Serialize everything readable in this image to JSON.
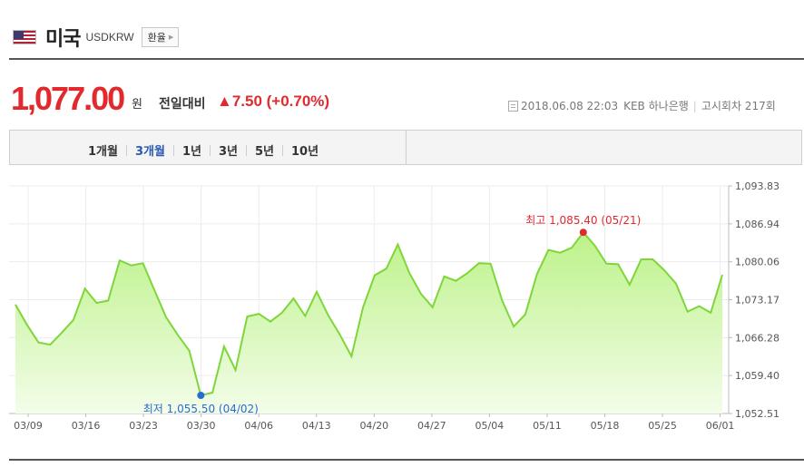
{
  "header": {
    "country": "미국",
    "code": "USDKRW",
    "rate_button": "환율"
  },
  "summary": {
    "price": "1,077.00",
    "unit": "원",
    "change_label": "전일대비",
    "change_value": "▲7.50 (+0.70%)",
    "datetime": "2018.06.08 22:03",
    "bank": "KEB 하나은행",
    "notice": "고시회차 217회"
  },
  "tabs": [
    {
      "label": "1개월",
      "active": false
    },
    {
      "label": "3개월",
      "active": true
    },
    {
      "label": "1년",
      "active": false
    },
    {
      "label": "3년",
      "active": false
    },
    {
      "label": "5년",
      "active": false
    },
    {
      "label": "10년",
      "active": false
    }
  ],
  "chart_data": {
    "type": "area",
    "x_tick_labels": [
      "03/09",
      "03/16",
      "03/23",
      "03/30",
      "04/06",
      "04/13",
      "04/20",
      "04/27",
      "05/04",
      "05/11",
      "05/18",
      "05/25",
      "06/01"
    ],
    "y_tick_labels": [
      "1,093.83",
      "1,086.94",
      "1,080.06",
      "1,073.17",
      "1,066.28",
      "1,059.40",
      "1,052.51"
    ],
    "ylim": [
      1052.51,
      1093.83
    ],
    "grid": true,
    "colors": {
      "line": "#7fd63a",
      "fill_top": "#bdf28a",
      "fill_bottom": "#f3fde9",
      "high": "#e1292e",
      "low": "#2a6bd0"
    },
    "series": [
      {
        "values": [
          1072.3,
          1068.6,
          1065.4,
          1065.0,
          1067.2,
          1069.5,
          1075.2,
          1072.6,
          1073.0,
          1080.3,
          1079.4,
          1079.8,
          1074.9,
          1070.0,
          1066.8,
          1063.9,
          1055.8,
          1056.3,
          1064.7,
          1060.4,
          1070.1,
          1070.6,
          1069.2,
          1070.8,
          1073.4,
          1070.2,
          1074.6,
          1070.3,
          1066.8,
          1062.9,
          1071.8,
          1077.6,
          1078.8,
          1083.2,
          1078.0,
          1074.2,
          1071.8,
          1077.4,
          1076.6,
          1078.0,
          1079.8,
          1079.7,
          1073.0,
          1068.3,
          1070.5,
          1077.8,
          1082.2,
          1081.7,
          1082.6,
          1085.4,
          1083.0,
          1079.7,
          1079.6,
          1075.9,
          1080.5,
          1080.5,
          1078.5,
          1076.1,
          1071.0,
          1072.0,
          1070.8,
          1077.7
        ]
      }
    ],
    "high": {
      "label": "최고 1,085.40 (05/21)",
      "value": 1085.4
    },
    "low": {
      "label": "최저 1,055.50 (04/02)",
      "value": 1055.5
    }
  }
}
